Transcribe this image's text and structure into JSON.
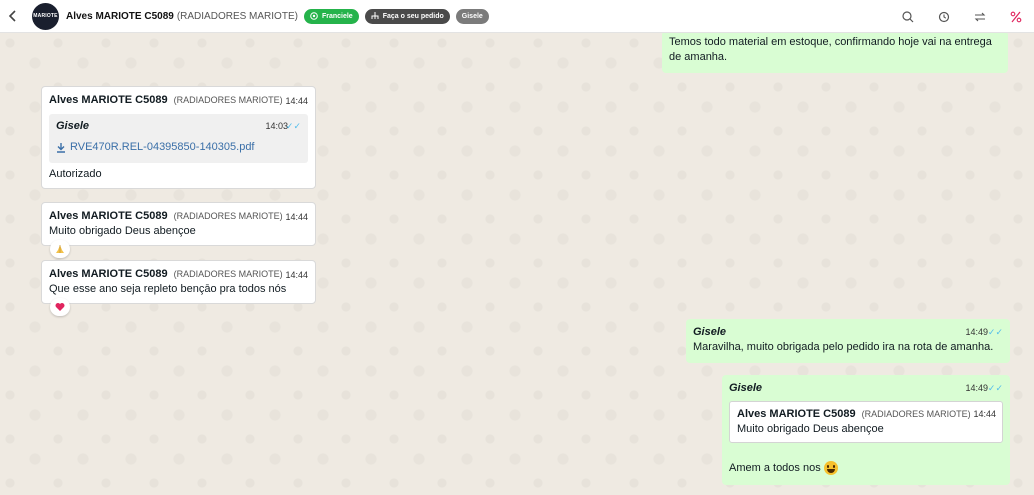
{
  "header": {
    "contact_name": "Alves MARIOTE C5089",
    "contact_company": "(RADIADORES MARIOTE)",
    "avatar_text": "MARIOTE",
    "tags": [
      {
        "label": "Franciele",
        "color": "#25b34b"
      },
      {
        "label": "Faça o seu pedido",
        "color": "#4a4a4a"
      },
      {
        "label": "Gisele",
        "color": "#7b7b7b"
      }
    ],
    "icons": [
      "search-icon",
      "history-icon",
      "transfer-icon",
      "percent-icon"
    ]
  },
  "messages": {
    "m0": {
      "text": "Temos todo material em estoque, confirmando hoje vai na entrega de amanha."
    },
    "m1": {
      "sender": "Alves MARIOTE C5089",
      "company": "(RADIADORES MARIOTE)",
      "time": "14:44",
      "quote_name": "Gisele",
      "quote_time": "14:03",
      "file_name": "RVE470R.REL-04395850-140305.pdf",
      "text": "Autorizado"
    },
    "m2": {
      "sender": "Alves MARIOTE C5089",
      "company": "(RADIADORES MARIOTE)",
      "time": "14:44",
      "text": "Muito obrigado Deus abençoe",
      "reaction": "praying-hands"
    },
    "m3": {
      "sender": "Alves MARIOTE C5089",
      "company": "(RADIADORES MARIOTE)",
      "time": "14:44",
      "text": "Que esse ano seja repleto bençāo pra todos nós",
      "reaction": "heart"
    },
    "m4": {
      "sender": "Gisele",
      "time": "14:49",
      "text": "Maravilha, muito obrigada pelo pedido ira na rota de amanha."
    },
    "m5": {
      "sender": "Gisele",
      "time": "14:49",
      "quote_sender": "Alves MARIOTE C5089",
      "quote_company": "(RADIADORES MARIOTE)",
      "quote_time": "14:44",
      "quote_text": "Muito obrigado Deus abençoe",
      "text": "Amem a todos nos"
    }
  },
  "colors": {
    "outgoing_bubble": "#d9fdd3",
    "incoming_bubble": "#ffffff",
    "ticks": "#53bdeb",
    "chat_background": "#efeae2"
  }
}
